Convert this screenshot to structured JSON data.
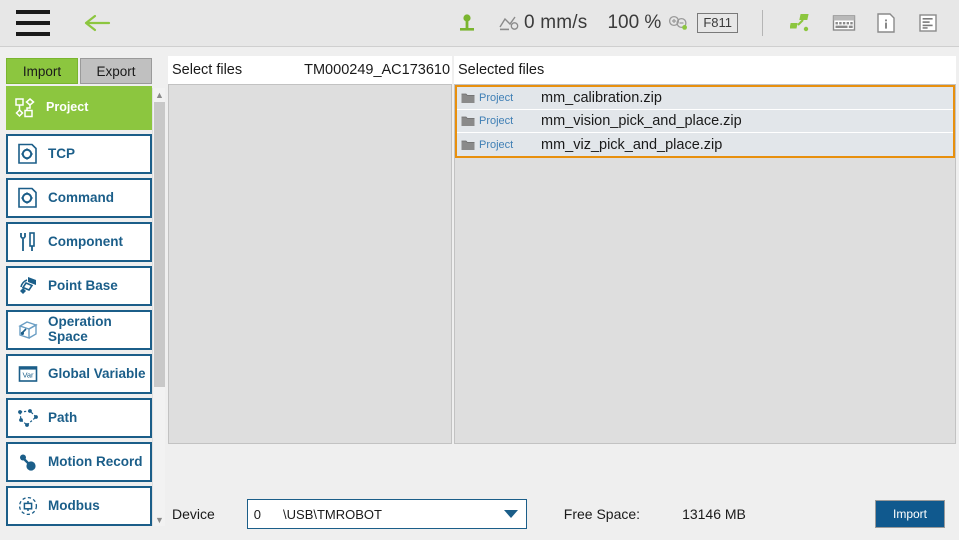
{
  "topbar": {
    "menu_icon": "hamburger-menu-icon",
    "back_icon": "back-arrow-icon",
    "robot_icon": "robot-base-icon",
    "speed_icon": "speed-gauge-icon",
    "speed_value": "0 mm/s",
    "zoom_value": "100 %",
    "zoom_icon": "zoom-in-out-icon",
    "function_key": "F811",
    "icons": [
      {
        "name": "robot-link-icon"
      },
      {
        "name": "keyboard-icon"
      },
      {
        "name": "info-icon"
      },
      {
        "name": "log-icon"
      }
    ]
  },
  "sidebar": {
    "tabs": [
      {
        "label": "Import",
        "active": true
      },
      {
        "label": "Export",
        "active": false
      }
    ],
    "items": [
      {
        "label": "Project",
        "icon": "project-node-icon",
        "active": true
      },
      {
        "label": "TCP",
        "icon": "tcp-gear-file-icon",
        "active": false
      },
      {
        "label": "Command",
        "icon": "command-gear-file-icon",
        "active": false
      },
      {
        "label": "Component",
        "icon": "component-tools-icon",
        "active": false
      },
      {
        "label": "Point Base",
        "icon": "point-base-icon",
        "active": false
      },
      {
        "label": "Operation\nSpace",
        "icon": "operation-space-icon",
        "active": false
      },
      {
        "label": "Global Variable",
        "icon": "global-variable-icon",
        "active": false
      },
      {
        "label": "Path",
        "icon": "path-icon",
        "active": false
      },
      {
        "label": "Motion Record",
        "icon": "motion-record-icon",
        "active": false
      },
      {
        "label": "Modbus",
        "icon": "modbus-icon",
        "active": false
      }
    ]
  },
  "select_panel": {
    "title": "Select files",
    "subtitle": "TM000249_AC173610"
  },
  "selected_panel": {
    "title": "Selected files",
    "files": [
      {
        "type": "Project",
        "name": "mm_calibration.zip"
      },
      {
        "type": "Project",
        "name": "mm_vision_pick_and_place.zip"
      },
      {
        "type": "Project",
        "name": "mm_viz_pick_and_place.zip"
      }
    ]
  },
  "bottom": {
    "device_label": "Device",
    "device_index": "0",
    "device_path": "\\USB\\TMROBOT",
    "free_space_label": "Free Space:",
    "free_space_value": "13146 MB",
    "import_button": "Import"
  },
  "colors": {
    "accent_green": "#8cc63f",
    "accent_blue": "#1b5e89",
    "selection_orange": "#e8900e",
    "button_blue": "#10598e"
  }
}
